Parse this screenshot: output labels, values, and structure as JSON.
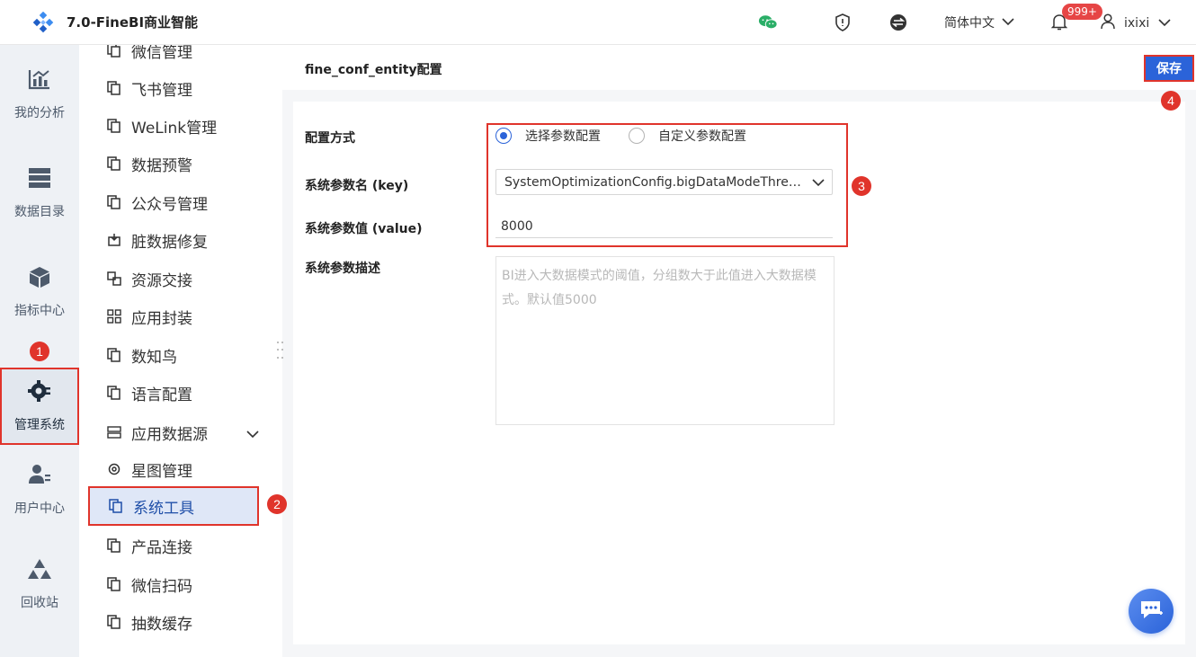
{
  "app": {
    "title": "7.0-FineBI商业智能"
  },
  "topbar": {
    "language": "简体中文",
    "notifications_badge": "999+",
    "username": "ixixi",
    "icons": [
      "wechat-icon",
      "shield-icon",
      "switch-icon",
      "bell-icon",
      "user-icon"
    ],
    "wechat_color": "#2aae67"
  },
  "rail": {
    "items": [
      {
        "label": "我的分析",
        "icon": "analysis-chart-icon"
      },
      {
        "label": "数据目录",
        "icon": "database-icon"
      },
      {
        "label": "指标中心",
        "icon": "cube-icon"
      },
      {
        "label": "管理系统",
        "icon": "gear-icon",
        "active": true
      },
      {
        "label": "用户中心",
        "icon": "user-admin-icon"
      },
      {
        "label": "回收站",
        "icon": "recycle-icon"
      }
    ]
  },
  "subnav": {
    "items": [
      {
        "label": "微信管理",
        "icon": "copy-icon"
      },
      {
        "label": "飞书管理",
        "icon": "copy-icon"
      },
      {
        "label": "WeLink管理",
        "icon": "copy-icon"
      },
      {
        "label": "数据预警",
        "icon": "copy-icon"
      },
      {
        "label": "公众号管理",
        "icon": "copy-icon"
      },
      {
        "label": "脏数据修复",
        "icon": "repair-icon"
      },
      {
        "label": "资源交接",
        "icon": "exchange-icon"
      },
      {
        "label": "应用封装",
        "icon": "grid-icon"
      },
      {
        "label": "数知鸟",
        "icon": "copy-icon"
      },
      {
        "label": "语言配置",
        "icon": "copy-icon"
      },
      {
        "label": "应用数据源",
        "icon": "server-icon",
        "expandable": true
      },
      {
        "label": "星图管理",
        "icon": "settings-icon"
      },
      {
        "label": "系统工具",
        "icon": "copy-icon",
        "active": true
      },
      {
        "label": "产品连接",
        "icon": "copy-icon"
      },
      {
        "label": "微信扫码",
        "icon": "copy-icon"
      },
      {
        "label": "抽数缓存",
        "icon": "copy-icon"
      }
    ]
  },
  "main": {
    "header_title": "fine_conf_entity配置",
    "save_label": "保存",
    "form": {
      "mode_label": "配置方式",
      "mode_options": [
        {
          "label": "选择参数配置",
          "checked": true
        },
        {
          "label": "自定义参数配置",
          "checked": false
        }
      ],
      "key_label": "系统参数名 (key)",
      "key_value": "SystemOptimizationConfig.bigDataModeThres...",
      "value_label": "系统参数值 (value)",
      "value_value": "8000",
      "desc_label": "系统参数描述",
      "desc_text": "BI进入大数据模式的阈值，分组数大于此值进入大数据模式。默认值5000"
    }
  },
  "markers": [
    "1",
    "2",
    "3",
    "4"
  ],
  "colors": {
    "accent": "#2b63d9",
    "highlight": "#e0342b",
    "badge": "#e64545"
  }
}
